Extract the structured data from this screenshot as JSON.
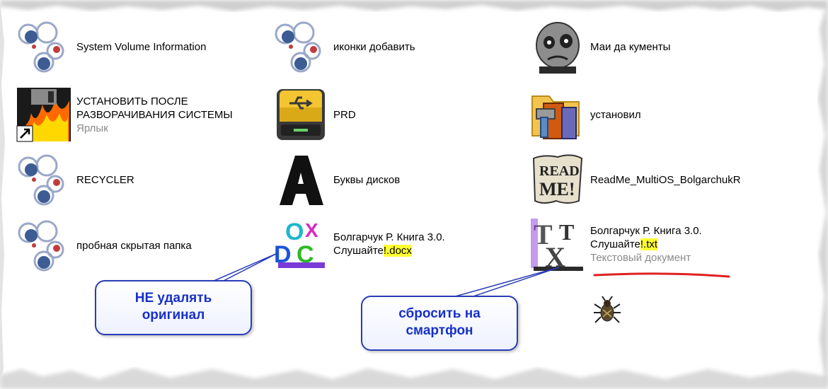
{
  "folder_items": [
    {
      "name": "System Volume Information",
      "icon": "hidden-system-folder-icon"
    },
    {
      "name": "иконки добавить",
      "icon": "hidden-system-folder-icon"
    },
    {
      "name": "Маи да кументы",
      "icon": "skull-folder-icon"
    },
    {
      "name_line1": "УСТАНОВИТЬ ПОСЛЕ",
      "name_line2": "РАЗВОРАЧИВАНИЯ СИСТЕМЫ",
      "type": "Ярлык",
      "icon": "fire-floppy-shortcut-icon"
    },
    {
      "name": "PRD",
      "icon": "usb-drive-icon"
    },
    {
      "name": "установил",
      "icon": "installer-folder-icon"
    },
    {
      "name": "RECYCLER",
      "icon": "hidden-system-folder-icon"
    },
    {
      "name": "Буквы дисков",
      "icon": "letter-a-icon"
    },
    {
      "name": "ReadMe_MultiOS_BolgarchukR",
      "icon": "readme-scroll-icon"
    },
    {
      "name": "пробная скрытая папка",
      "icon": "hidden-system-folder-icon"
    },
    {
      "name_line1": "Болгарчук Р.  Книга 3.0.",
      "name_line2_prefix": "Слушайте",
      "name_ext": "!.docx",
      "icon": "docx-file-icon"
    },
    {
      "name_line1": "Болгарчук Р.  Книга 3.0.",
      "name_line2_prefix": "Слушайте",
      "name_ext": "!.txt",
      "type": "Текстовый документ",
      "icon": "txt-file-icon"
    }
  ],
  "callouts": [
    {
      "line1": "НЕ удалять",
      "line2": "оригинал"
    },
    {
      "line1": "сбросить на",
      "line2": "смартфон"
    }
  ],
  "decor": {
    "bug_icon": "bug-icon",
    "accent": "#2a3db8",
    "highlight": "#ffff33",
    "underline": "#e02020"
  }
}
